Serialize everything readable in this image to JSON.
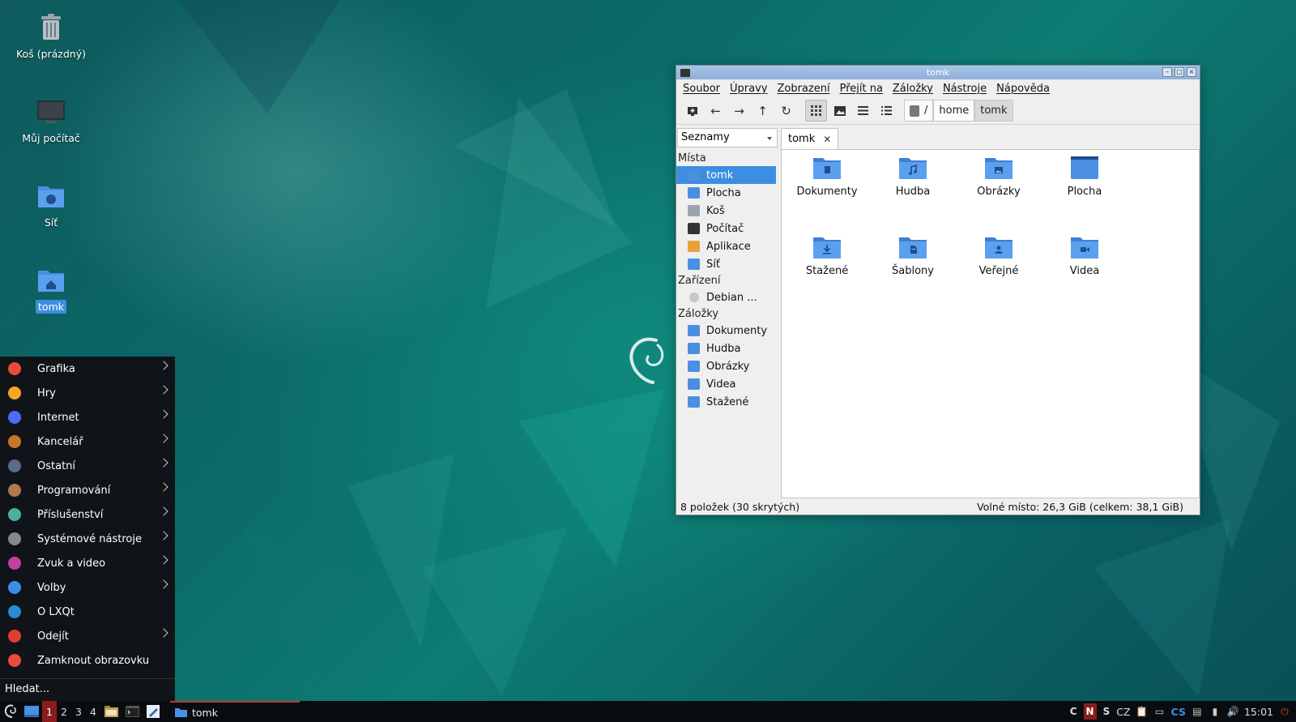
{
  "desktop": {
    "icons": [
      {
        "label": "Koš (prázdný)",
        "icon": "trash-icon"
      },
      {
        "label": "Můj počítač",
        "icon": "computer-icon"
      },
      {
        "label": "Síť",
        "icon": "network-folder-icon"
      },
      {
        "label": "tomk",
        "icon": "home-folder-icon"
      }
    ]
  },
  "start_menu": {
    "items": [
      {
        "label": "Grafika",
        "icon": "graphics-icon",
        "color": "#e74c3c",
        "submenu": true
      },
      {
        "label": "Hry",
        "icon": "games-icon",
        "color": "#f5a623",
        "submenu": true
      },
      {
        "label": "Internet",
        "icon": "internet-icon",
        "color": "#4a6cf7",
        "submenu": true
      },
      {
        "label": "Kancelář",
        "icon": "office-icon",
        "color": "#c8742a",
        "submenu": true
      },
      {
        "label": "Ostatní",
        "icon": "other-icon",
        "color": "#5a6a8a",
        "submenu": true
      },
      {
        "label": "Programování",
        "icon": "programming-icon",
        "color": "#b07a4a",
        "submenu": true
      },
      {
        "label": "Příslušenství",
        "icon": "accessories-icon",
        "color": "#4ab0a0",
        "submenu": true
      },
      {
        "label": "Systémové nástroje",
        "icon": "system-tools-icon",
        "color": "#888888",
        "submenu": true
      },
      {
        "label": "Zvuk a video",
        "icon": "multimedia-icon",
        "color": "#c040a0",
        "submenu": true
      },
      {
        "label": "Volby",
        "icon": "settings-icon",
        "color": "#3a8ee6",
        "submenu": true
      },
      {
        "label": "O LXQt",
        "icon": "about-icon",
        "color": "#2a8ad6",
        "submenu": false
      },
      {
        "label": "Odejít",
        "icon": "logout-icon",
        "color": "#e03c31",
        "submenu": true
      },
      {
        "label": "Zamknout obrazovku",
        "icon": "lock-icon",
        "color": "#e84c3d",
        "submenu": false
      }
    ],
    "search_placeholder": "Hledat..."
  },
  "window": {
    "title": "tomk",
    "menubar": [
      "Soubor",
      "Úpravy",
      "Zobrazení",
      "Přejít na",
      "Záložky",
      "Nástroje",
      "Nápověda"
    ],
    "breadcrumbs": [
      "/",
      "home",
      "tomk"
    ],
    "side_mode": "Seznamy",
    "sidebar": {
      "places_header": "Místa",
      "places": [
        "tomk",
        "Plocha",
        "Koš",
        "Počítač",
        "Aplikace",
        "Síť"
      ],
      "devices_header": "Zařízení",
      "devices": [
        "Debian ..."
      ],
      "bookmarks_header": "Záložky",
      "bookmarks": [
        "Dokumenty",
        "Hudba",
        "Obrázky",
        "Videa",
        "Stažené"
      ]
    },
    "tab_label": "tomk",
    "files": [
      {
        "label": "Dokumenty",
        "icon": "documents-folder-icon"
      },
      {
        "label": "Hudba",
        "icon": "music-folder-icon"
      },
      {
        "label": "Obrázky",
        "icon": "pictures-folder-icon"
      },
      {
        "label": "Plocha",
        "icon": "desktop-folder-icon"
      },
      {
        "label": "Stažené",
        "icon": "downloads-folder-icon"
      },
      {
        "label": "Šablony",
        "icon": "templates-folder-icon"
      },
      {
        "label": "Veřejné",
        "icon": "public-folder-icon"
      },
      {
        "label": "Videa",
        "icon": "videos-folder-icon"
      }
    ],
    "status_left": "8 položek (30 skrytých)",
    "status_right": "Volné místo: 26,3 GiB (celkem: 38,1 GiB)"
  },
  "taskbar": {
    "desktops": [
      "1",
      "2",
      "3",
      "4"
    ],
    "active_task": "tomk",
    "kbd_indicators": [
      "C",
      "N",
      "S"
    ],
    "layout": "CZ",
    "lang": "CS",
    "clock": "15:01"
  },
  "colors": {
    "accent": "#3d8ee0",
    "folder": "#4a8fe0",
    "taskbar_active": "#8b1c1c"
  }
}
